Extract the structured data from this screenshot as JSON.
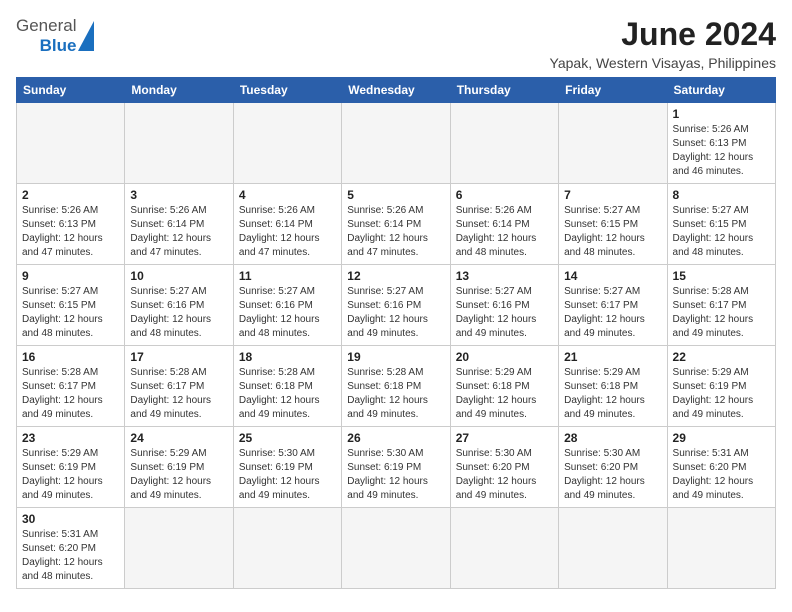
{
  "header": {
    "logo_general": "General",
    "logo_blue": "Blue",
    "month_title": "June 2024",
    "location": "Yapak, Western Visayas, Philippines"
  },
  "days_of_week": [
    "Sunday",
    "Monday",
    "Tuesday",
    "Wednesday",
    "Thursday",
    "Friday",
    "Saturday"
  ],
  "weeks": [
    [
      null,
      null,
      null,
      null,
      null,
      null,
      {
        "day": 1,
        "sunrise": "5:26 AM",
        "sunset": "6:13 PM",
        "daylight": "12 hours and 46 minutes."
      }
    ],
    [
      {
        "day": 2,
        "sunrise": "5:26 AM",
        "sunset": "6:13 PM",
        "daylight": "12 hours and 47 minutes."
      },
      {
        "day": 3,
        "sunrise": "5:26 AM",
        "sunset": "6:14 PM",
        "daylight": "12 hours and 47 minutes."
      },
      {
        "day": 4,
        "sunrise": "5:26 AM",
        "sunset": "6:14 PM",
        "daylight": "12 hours and 47 minutes."
      },
      {
        "day": 5,
        "sunrise": "5:26 AM",
        "sunset": "6:14 PM",
        "daylight": "12 hours and 47 minutes."
      },
      {
        "day": 6,
        "sunrise": "5:26 AM",
        "sunset": "6:14 PM",
        "daylight": "12 hours and 48 minutes."
      },
      {
        "day": 7,
        "sunrise": "5:27 AM",
        "sunset": "6:15 PM",
        "daylight": "12 hours and 48 minutes."
      },
      {
        "day": 8,
        "sunrise": "5:27 AM",
        "sunset": "6:15 PM",
        "daylight": "12 hours and 48 minutes."
      }
    ],
    [
      {
        "day": 9,
        "sunrise": "5:27 AM",
        "sunset": "6:15 PM",
        "daylight": "12 hours and 48 minutes."
      },
      {
        "day": 10,
        "sunrise": "5:27 AM",
        "sunset": "6:16 PM",
        "daylight": "12 hours and 48 minutes."
      },
      {
        "day": 11,
        "sunrise": "5:27 AM",
        "sunset": "6:16 PM",
        "daylight": "12 hours and 48 minutes."
      },
      {
        "day": 12,
        "sunrise": "5:27 AM",
        "sunset": "6:16 PM",
        "daylight": "12 hours and 49 minutes."
      },
      {
        "day": 13,
        "sunrise": "5:27 AM",
        "sunset": "6:16 PM",
        "daylight": "12 hours and 49 minutes."
      },
      {
        "day": 14,
        "sunrise": "5:27 AM",
        "sunset": "6:17 PM",
        "daylight": "12 hours and 49 minutes."
      },
      {
        "day": 15,
        "sunrise": "5:28 AM",
        "sunset": "6:17 PM",
        "daylight": "12 hours and 49 minutes."
      }
    ],
    [
      {
        "day": 16,
        "sunrise": "5:28 AM",
        "sunset": "6:17 PM",
        "daylight": "12 hours and 49 minutes."
      },
      {
        "day": 17,
        "sunrise": "5:28 AM",
        "sunset": "6:17 PM",
        "daylight": "12 hours and 49 minutes."
      },
      {
        "day": 18,
        "sunrise": "5:28 AM",
        "sunset": "6:18 PM",
        "daylight": "12 hours and 49 minutes."
      },
      {
        "day": 19,
        "sunrise": "5:28 AM",
        "sunset": "6:18 PM",
        "daylight": "12 hours and 49 minutes."
      },
      {
        "day": 20,
        "sunrise": "5:29 AM",
        "sunset": "6:18 PM",
        "daylight": "12 hours and 49 minutes."
      },
      {
        "day": 21,
        "sunrise": "5:29 AM",
        "sunset": "6:18 PM",
        "daylight": "12 hours and 49 minutes."
      },
      {
        "day": 22,
        "sunrise": "5:29 AM",
        "sunset": "6:19 PM",
        "daylight": "12 hours and 49 minutes."
      }
    ],
    [
      {
        "day": 23,
        "sunrise": "5:29 AM",
        "sunset": "6:19 PM",
        "daylight": "12 hours and 49 minutes."
      },
      {
        "day": 24,
        "sunrise": "5:29 AM",
        "sunset": "6:19 PM",
        "daylight": "12 hours and 49 minutes."
      },
      {
        "day": 25,
        "sunrise": "5:30 AM",
        "sunset": "6:19 PM",
        "daylight": "12 hours and 49 minutes."
      },
      {
        "day": 26,
        "sunrise": "5:30 AM",
        "sunset": "6:19 PM",
        "daylight": "12 hours and 49 minutes."
      },
      {
        "day": 27,
        "sunrise": "5:30 AM",
        "sunset": "6:20 PM",
        "daylight": "12 hours and 49 minutes."
      },
      {
        "day": 28,
        "sunrise": "5:30 AM",
        "sunset": "6:20 PM",
        "daylight": "12 hours and 49 minutes."
      },
      {
        "day": 29,
        "sunrise": "5:31 AM",
        "sunset": "6:20 PM",
        "daylight": "12 hours and 49 minutes."
      }
    ],
    [
      {
        "day": 30,
        "sunrise": "5:31 AM",
        "sunset": "6:20 PM",
        "daylight": "12 hours and 48 minutes."
      },
      null,
      null,
      null,
      null,
      null,
      null
    ]
  ]
}
